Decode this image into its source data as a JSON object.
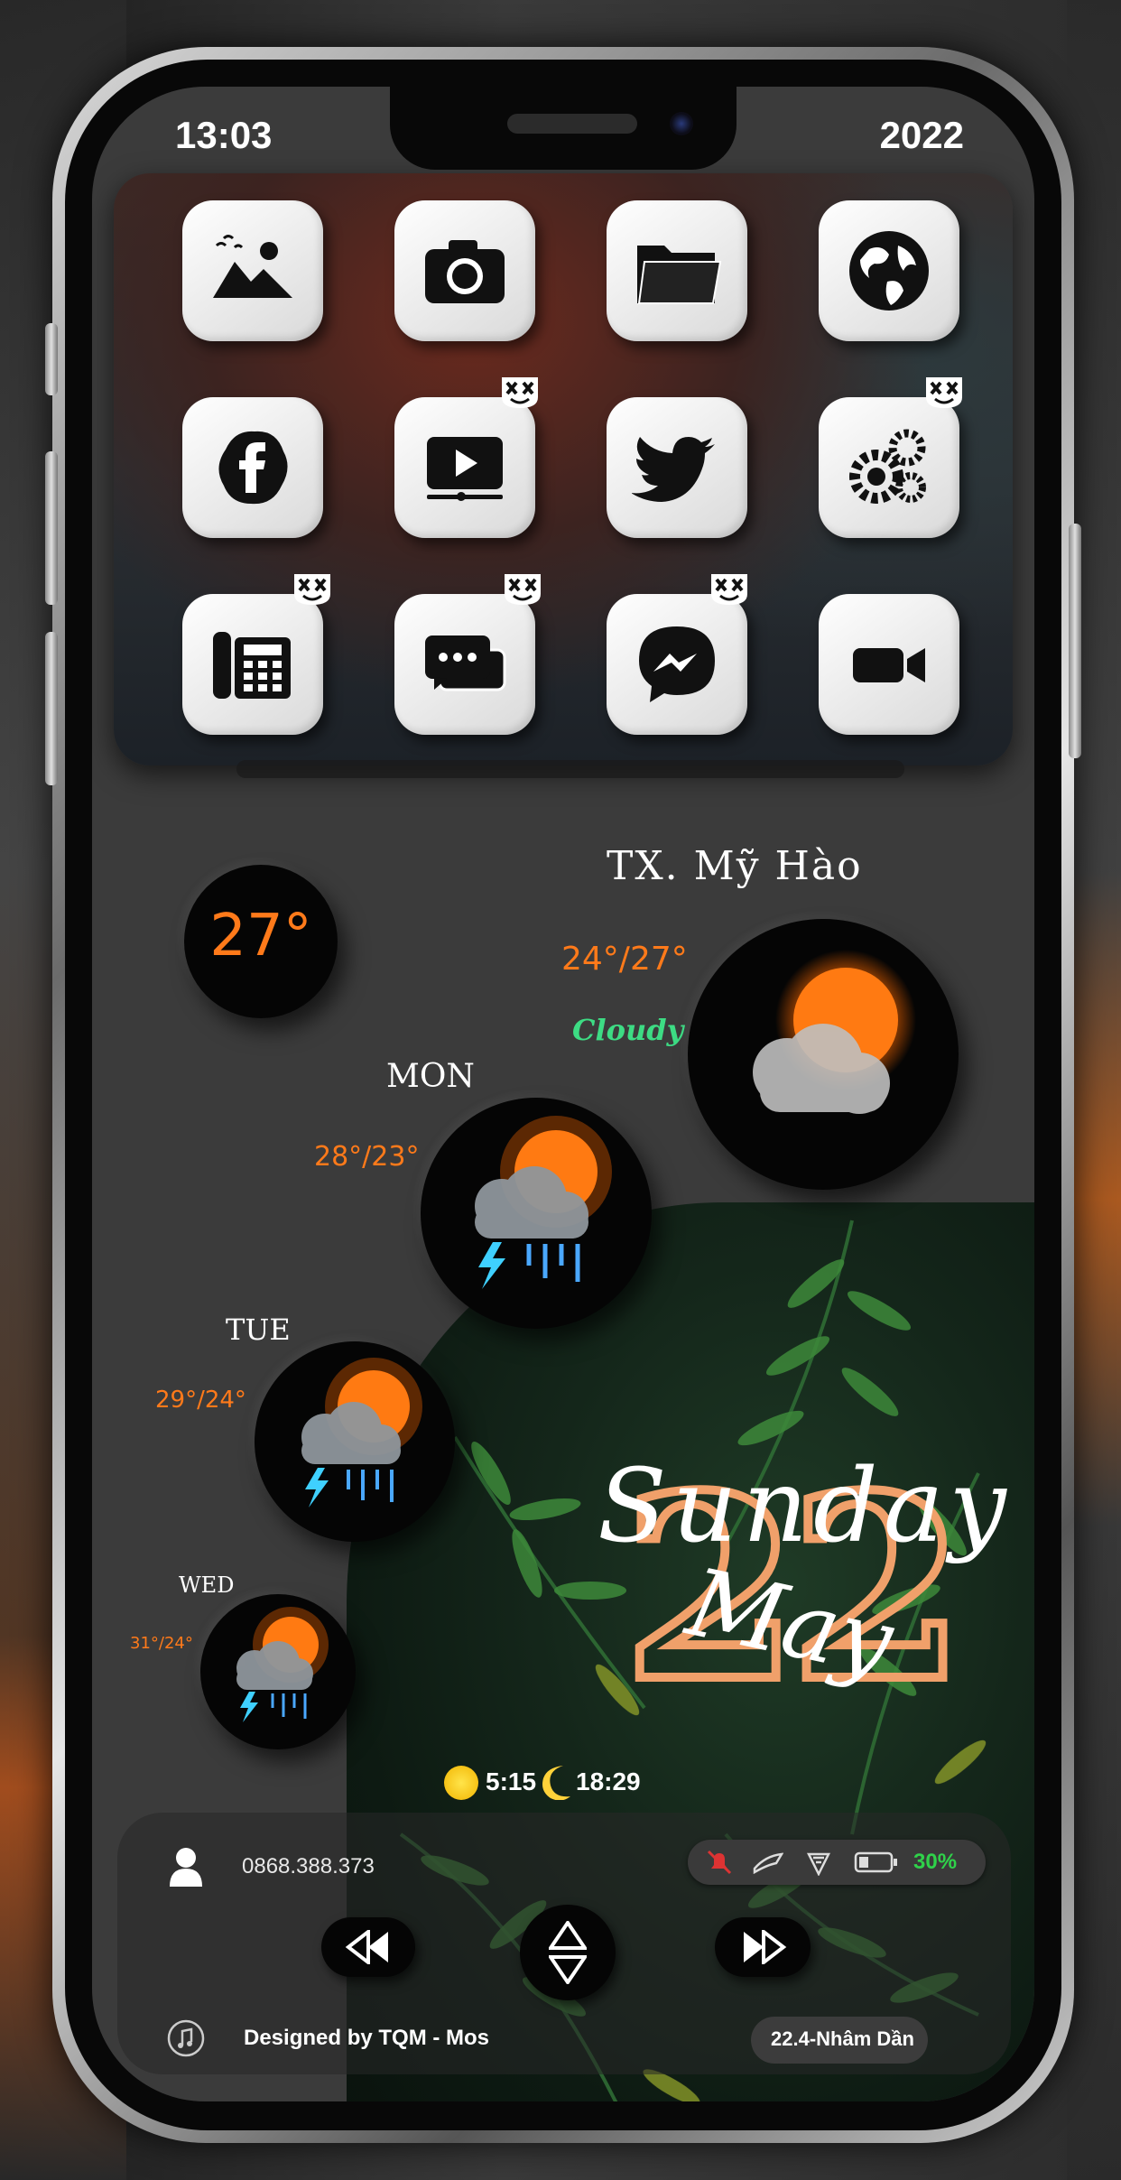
{
  "status_bar": {
    "time": "13:03",
    "year": "2022"
  },
  "apps": [
    {
      "name": "photos-icon"
    },
    {
      "name": "camera-icon"
    },
    {
      "name": "files-icon"
    },
    {
      "name": "browser-globe-icon"
    },
    {
      "name": "facebook-icon"
    },
    {
      "name": "youtube-icon"
    },
    {
      "name": "twitter-icon"
    },
    {
      "name": "settings-gear-icon"
    },
    {
      "name": "phone-icon"
    },
    {
      "name": "messages-icon"
    },
    {
      "name": "messenger-icon"
    },
    {
      "name": "facetime-icon"
    }
  ],
  "weather": {
    "current_temp": "27°",
    "location": "TX. Mỹ Hào",
    "today_range": "24°/27°",
    "condition": "Cloudy",
    "forecast": [
      {
        "day": "MON",
        "range": "28°/23°"
      },
      {
        "day": "TUE",
        "range": "29°/24°"
      },
      {
        "day": "WED",
        "range": "31°/24°"
      }
    ]
  },
  "date_widget": {
    "weekday": "Sunday",
    "day": "22",
    "month": "May"
  },
  "sun": {
    "sunrise": "5:15",
    "sunset": "18:29"
  },
  "contact": {
    "phone": "0868.388.373"
  },
  "device_status": {
    "battery": "30%"
  },
  "footer": {
    "credit": "Designed by TQM - Mos",
    "lunar_date": "22.4-Nhâm Dần"
  },
  "colors": {
    "accent_orange": "#ff7a1a",
    "condition_green": "#3ddc84",
    "battery_green": "#2fd24a"
  }
}
